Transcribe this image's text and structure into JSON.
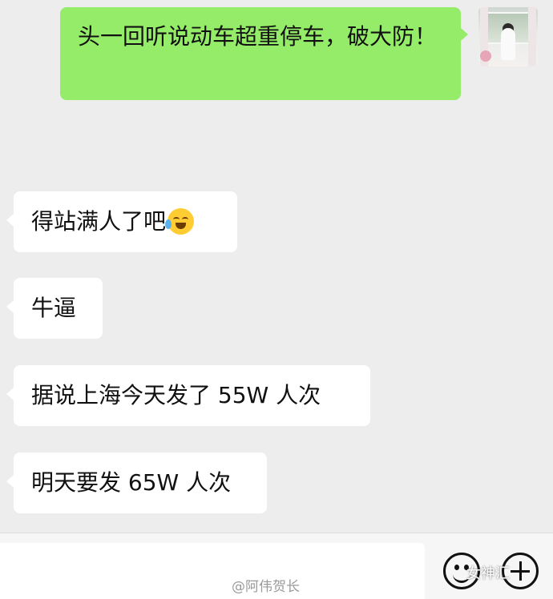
{
  "messages": [
    {
      "id": "m1",
      "direction": "outgoing",
      "text": "头一回听说动车超重停车，破大防！"
    },
    {
      "id": "m2",
      "direction": "incoming",
      "text": "得站满人了吧",
      "emoji": "face-with-tears-of-joy"
    },
    {
      "id": "m3",
      "direction": "incoming",
      "text": "牛逼"
    },
    {
      "id": "m4",
      "direction": "incoming",
      "text": "据说上海今天发了 55W 人次"
    },
    {
      "id": "m5",
      "direction": "incoming",
      "text": "明天要发 65W 人次"
    }
  ],
  "input_bar": {
    "emoji_icon": "emoji-icon",
    "add_icon": "plus-icon"
  },
  "watermarks": {
    "weibo": "@阿伟贺长",
    "brand": "女神汇"
  },
  "colors": {
    "outgoing_bubble": "#95ec69",
    "incoming_bubble": "#ffffff",
    "background": "#ededed"
  }
}
